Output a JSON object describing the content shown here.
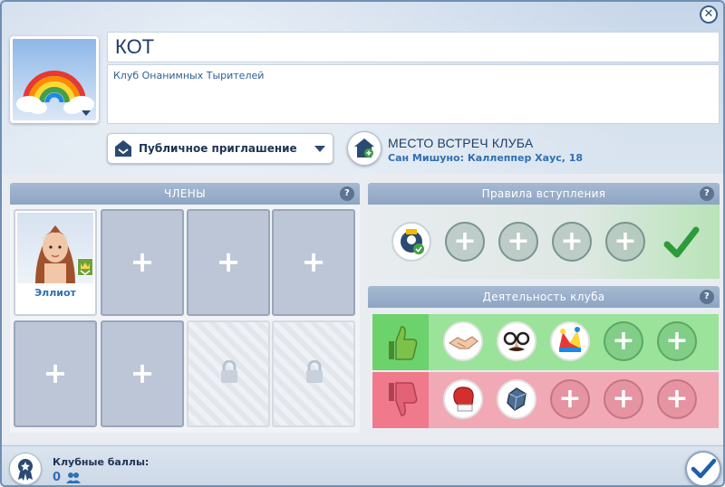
{
  "club": {
    "name": "КОТ",
    "description": "Клуб Онанимных Тырителей"
  },
  "invite": {
    "selected_label": "Публичное приглашение"
  },
  "venue": {
    "title": "Место встреч клуба",
    "location": "Сан Мишуно: Каллеппер Хаус, 18"
  },
  "members_panel": {
    "title": "ЧЛЕНЫ",
    "help": "?",
    "members": [
      {
        "name": "Эллиот"
      }
    ]
  },
  "rules_panel": {
    "title": "Правила вступления",
    "help": "?"
  },
  "activity_panel": {
    "title": "Деятельность клуба",
    "help": "?",
    "likes": [
      "handshake-icon",
      "disguise-glasses-icon",
      "jester-hat-icon"
    ],
    "dislikes": [
      "boxing-glove-icon",
      "gem-icon"
    ]
  },
  "footer": {
    "points_label": "Клубные баллы:",
    "points_value": "0"
  },
  "colors": {
    "accent": "#2f6fb4",
    "header": "#8ea5c2",
    "like": "#9be39a",
    "dislike": "#f2a9b6"
  }
}
